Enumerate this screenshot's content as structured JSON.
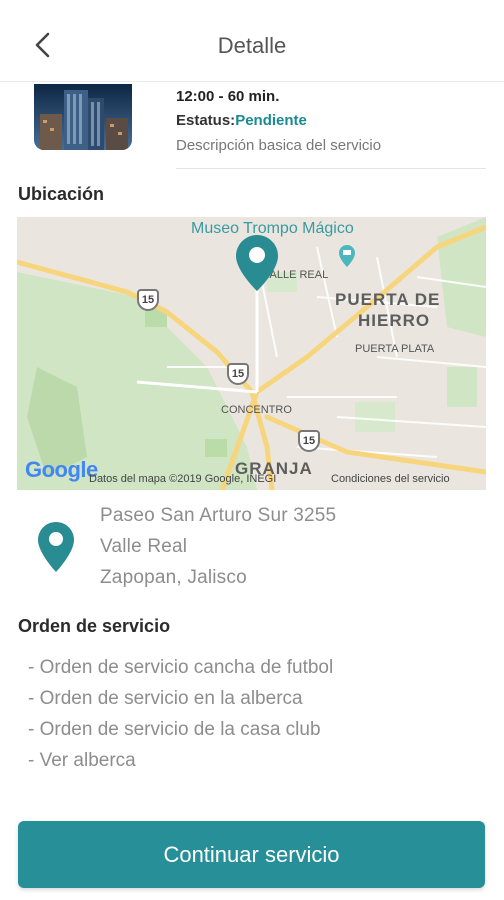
{
  "header": {
    "title": "Detalle",
    "back_icon": "chevron-left-icon"
  },
  "service": {
    "time": "12:00 - 60 min.",
    "status_label": "Estatus:",
    "status_value": "Pendiente",
    "description": "Descripción basica del servicio"
  },
  "location": {
    "title": "Ubicación",
    "map": {
      "poi": "Museo Trompo Mágico",
      "labels": {
        "valle_real": "VALLE REAL",
        "puerta_de_hierro_1": "PUERTA DE",
        "puerta_de_hierro_2": "HIERRO",
        "puerta_plata": "PUERTA PLATA",
        "concentro": "CONCENTRO",
        "granja": "GRANJA"
      },
      "shields": [
        "15",
        "15",
        "15"
      ],
      "google_logo": "Google",
      "attribution": "Datos del mapa ©2019 Google, INEGI",
      "terms": "Condiciones del servicio"
    },
    "address": [
      "Paseo San Arturo Sur 3255",
      "Valle Real",
      "Zapopan, Jalisco"
    ]
  },
  "orders": {
    "title": "Orden de servicio",
    "items": [
      "- Orden de servicio cancha de futbol",
      "- Orden de servicio en la alberca",
      "- Orden de servicio de la casa club",
      "- Ver alberca"
    ]
  },
  "cta": {
    "label": "Continuar servicio"
  },
  "colors": {
    "accent": "#278f97",
    "status": "#1a8a92",
    "pin": "#2a8c93"
  }
}
